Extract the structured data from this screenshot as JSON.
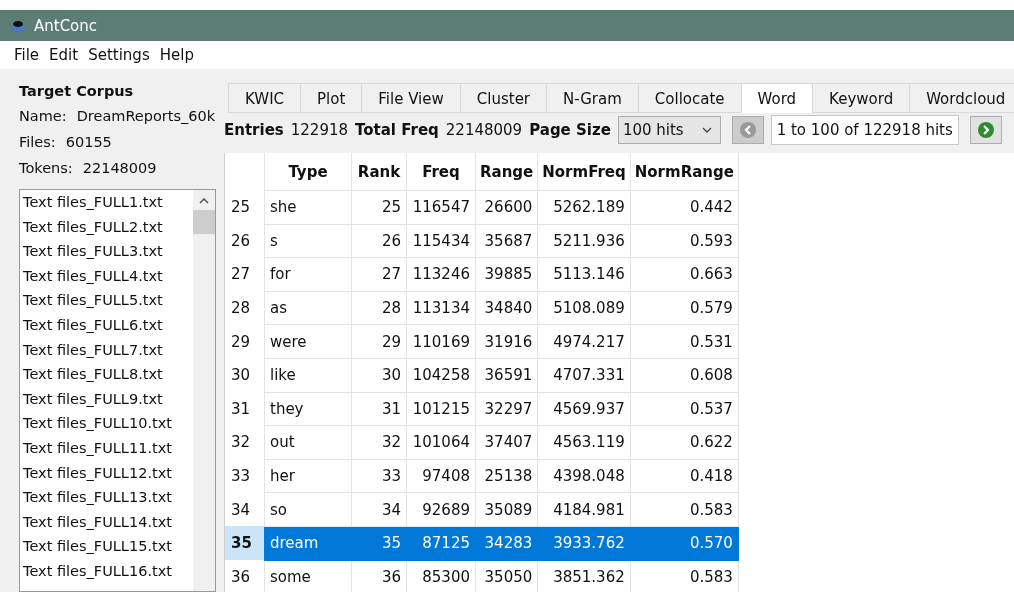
{
  "window": {
    "title": "AntConc"
  },
  "menu": [
    "File",
    "Edit",
    "Settings",
    "Help"
  ],
  "corpus": {
    "heading": "Target Corpus",
    "fields": [
      {
        "label": "Name:",
        "value": "DreamReports_60k"
      },
      {
        "label": "Files:",
        "value": "60155"
      },
      {
        "label": "Tokens:",
        "value": "22148009"
      }
    ],
    "files": [
      "Text files_FULL1.txt",
      "Text files_FULL2.txt",
      "Text files_FULL3.txt",
      "Text files_FULL4.txt",
      "Text files_FULL5.txt",
      "Text files_FULL6.txt",
      "Text files_FULL7.txt",
      "Text files_FULL8.txt",
      "Text files_FULL9.txt",
      "Text files_FULL10.txt",
      "Text files_FULL11.txt",
      "Text files_FULL12.txt",
      "Text files_FULL13.txt",
      "Text files_FULL14.txt",
      "Text files_FULL15.txt",
      "Text files_FULL16.txt"
    ]
  },
  "tabs": [
    {
      "label": "KWIC",
      "selected": false
    },
    {
      "label": "Plot",
      "selected": false
    },
    {
      "label": "File View",
      "selected": false
    },
    {
      "label": "Cluster",
      "selected": false
    },
    {
      "label": "N-Gram",
      "selected": false
    },
    {
      "label": "Collocate",
      "selected": false
    },
    {
      "label": "Word",
      "selected": true
    },
    {
      "label": "Keyword",
      "selected": false
    },
    {
      "label": "Wordcloud",
      "selected": false
    }
  ],
  "toolbar": {
    "entries_label": "Entries",
    "entries": "122918",
    "total_label": "Total Freq",
    "total": "22148009",
    "page_size_label": "Page Size",
    "page_size": "100 hits",
    "position": "1 to 100 of 122918 hits",
    "prev_disabled": true
  },
  "table": {
    "columns": [
      "Type",
      "Rank",
      "Freq",
      "Range",
      "NormFreq",
      "NormRange"
    ],
    "rows": [
      {
        "n": "25",
        "cells": [
          "she",
          "25",
          "116547",
          "26600",
          "5262.189",
          "0.442"
        ],
        "selected": false
      },
      {
        "n": "26",
        "cells": [
          "s",
          "26",
          "115434",
          "35687",
          "5211.936",
          "0.593"
        ],
        "selected": false
      },
      {
        "n": "27",
        "cells": [
          "for",
          "27",
          "113246",
          "39885",
          "5113.146",
          "0.663"
        ],
        "selected": false
      },
      {
        "n": "28",
        "cells": [
          "as",
          "28",
          "113134",
          "34840",
          "5108.089",
          "0.579"
        ],
        "selected": false
      },
      {
        "n": "29",
        "cells": [
          "were",
          "29",
          "110169",
          "31916",
          "4974.217",
          "0.531"
        ],
        "selected": false
      },
      {
        "n": "30",
        "cells": [
          "like",
          "30",
          "104258",
          "36591",
          "4707.331",
          "0.608"
        ],
        "selected": false
      },
      {
        "n": "31",
        "cells": [
          "they",
          "31",
          "101215",
          "32297",
          "4569.937",
          "0.537"
        ],
        "selected": false
      },
      {
        "n": "32",
        "cells": [
          "out",
          "32",
          "101064",
          "37407",
          "4563.119",
          "0.622"
        ],
        "selected": false
      },
      {
        "n": "33",
        "cells": [
          "her",
          "33",
          "97408",
          "25138",
          "4398.048",
          "0.418"
        ],
        "selected": false
      },
      {
        "n": "34",
        "cells": [
          "so",
          "34",
          "92689",
          "35089",
          "4184.981",
          "0.583"
        ],
        "selected": false
      },
      {
        "n": "35",
        "cells": [
          "dream",
          "35",
          "87125",
          "34283",
          "3933.762",
          "0.570"
        ],
        "selected": true
      },
      {
        "n": "36",
        "cells": [
          "some",
          "36",
          "85300",
          "35050",
          "3851.362",
          "0.583"
        ],
        "selected": false
      }
    ]
  }
}
